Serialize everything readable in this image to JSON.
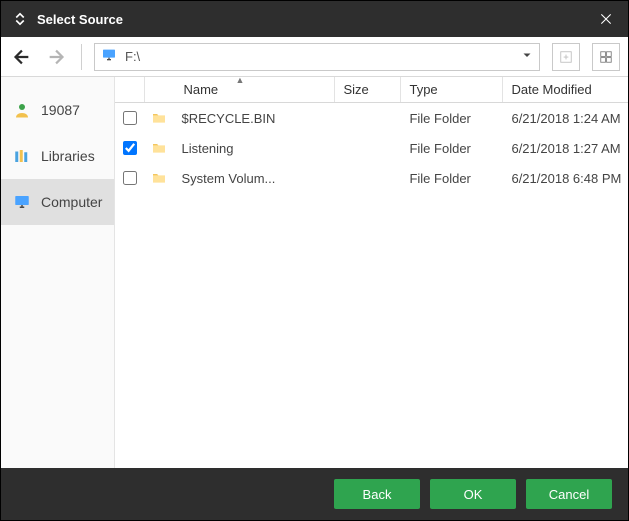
{
  "window": {
    "title": "Select Source"
  },
  "path": {
    "text": "F:\\"
  },
  "sidebar": {
    "items": [
      {
        "label": "19087",
        "active": false
      },
      {
        "label": "Libraries",
        "active": false
      },
      {
        "label": "Computer",
        "active": true
      }
    ]
  },
  "columns": {
    "name": "Name",
    "size": "Size",
    "type": "Type",
    "date": "Date Modified"
  },
  "rows": [
    {
      "checked": false,
      "name": "$RECYCLE.BIN",
      "size": "",
      "type": "File Folder",
      "date": "6/21/2018 1:24 AM"
    },
    {
      "checked": true,
      "name": "Listening",
      "size": "",
      "type": "File Folder",
      "date": "6/21/2018 1:27 AM"
    },
    {
      "checked": false,
      "name": "System Volum...",
      "size": "",
      "type": "File Folder",
      "date": "6/21/2018 6:48 PM"
    }
  ],
  "footer": {
    "back": "Back",
    "ok": "OK",
    "cancel": "Cancel"
  }
}
